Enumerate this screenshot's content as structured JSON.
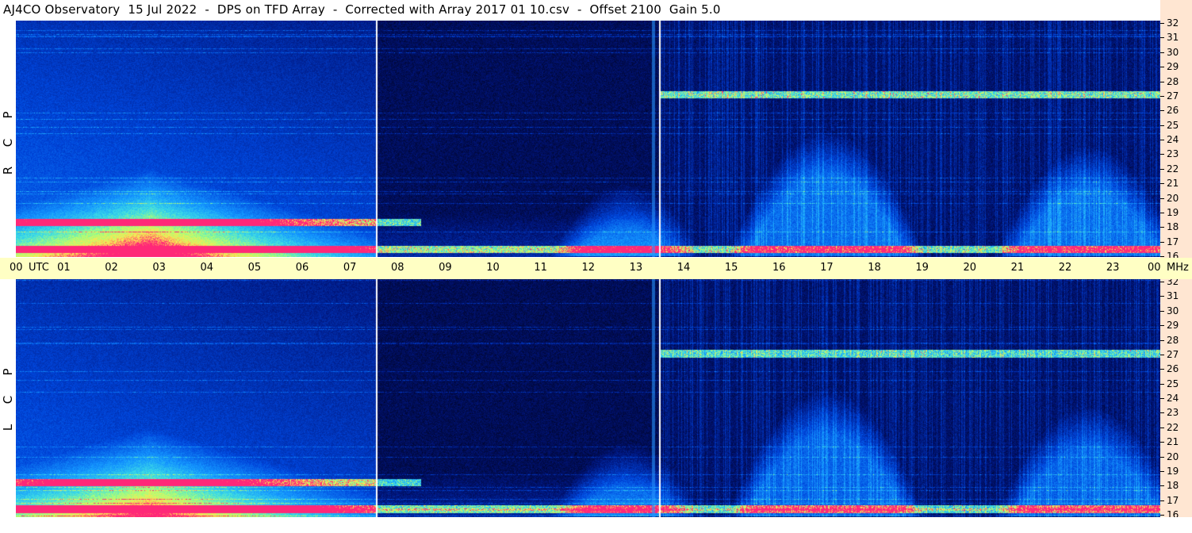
{
  "header": {
    "title": "AJ4CO Observatory  15 Jul 2022  -  DPS on TFD Array  -  Corrected with Array 2017 01 10.csv  -  Offset 2100  Gain 5.0"
  },
  "panels": [
    {
      "id": "rcp",
      "polarization_letters": [
        "R",
        "C",
        "P"
      ]
    },
    {
      "id": "lcp",
      "polarization_letters": [
        "L",
        "C",
        "P"
      ]
    }
  ],
  "time_axis": {
    "ticks": [
      "00",
      "01",
      "02",
      "03",
      "04",
      "05",
      "06",
      "07",
      "08",
      "09",
      "10",
      "11",
      "12",
      "13",
      "14",
      "15",
      "16",
      "17",
      "18",
      "19",
      "20",
      "21",
      "22",
      "23",
      "00"
    ],
    "unit_label": "UTC",
    "freq_unit_label": "MHz"
  },
  "freq_axis": {
    "ticks": [
      "32",
      "31",
      "30",
      "29",
      "28",
      "27",
      "26",
      "25",
      "24",
      "23",
      "22",
      "21",
      "20",
      "19",
      "18",
      "17",
      "16"
    ]
  },
  "colors": {
    "background_dark": "#000a3a",
    "axis_band": "#ffffc4",
    "side_band": "#ffe6d2",
    "marker_line": "#ffffff"
  },
  "chart_data": {
    "type": "heatmap",
    "title": "AJ4CO Observatory  15 Jul 2022  -  DPS on TFD Array  -  Corrected with Array 2017 01 10.csv  -  Offset 2100  Gain 5.0",
    "xlabel": "UTC",
    "ylabel": "MHz",
    "x_unit": "hours UTC",
    "y_unit": "MHz",
    "xlim": [
      0,
      24
    ],
    "ylim": [
      16,
      32
    ],
    "panels": [
      "RCP",
      "LCP"
    ],
    "marker_lines_utc": [
      7.55,
      13.5
    ],
    "features": [
      {
        "name": "strong band",
        "freq_mhz": 27.0,
        "utc_start": 13.5,
        "utc_end": 24
      },
      {
        "name": "strong band",
        "freq_mhz": 18.3,
        "utc_start": 0,
        "utc_end": 8.5
      },
      {
        "name": "strong band",
        "freq_mhz": 16.5,
        "utc_start": 0,
        "utc_end": 24
      },
      {
        "name": "ionospheric hump",
        "utc_peak": 17.0,
        "freq_top_mhz": 24.5
      },
      {
        "name": "ionospheric hump",
        "utc_peak": 22.5,
        "freq_top_mhz": 23.5
      },
      {
        "name": "ionospheric hump",
        "utc_peak": 12.8,
        "freq_top_mhz": 21.0
      },
      {
        "name": "daytime background",
        "utc_start": 0,
        "utc_end": 7.5,
        "freq_top_mhz": 22.0
      }
    ]
  }
}
